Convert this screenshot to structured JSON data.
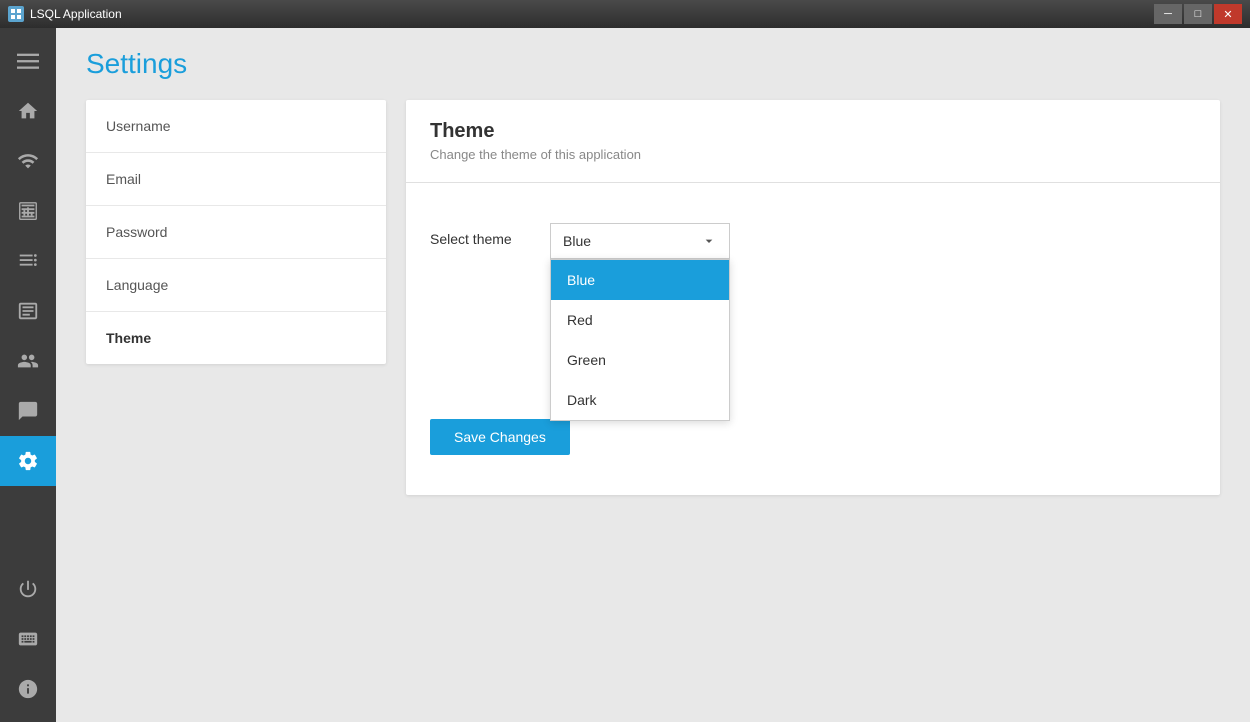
{
  "titlebar": {
    "title": "LSQL Application",
    "controls": {
      "minimize": "─",
      "maximize": "□",
      "close": "✕"
    }
  },
  "sidebar": {
    "items": [
      {
        "name": "menu-icon",
        "label": "Menu",
        "active": false
      },
      {
        "name": "home-icon",
        "label": "Home",
        "active": false
      },
      {
        "name": "wifi-icon",
        "label": "WiFi",
        "active": false
      },
      {
        "name": "chart-icon",
        "label": "Charts",
        "active": false
      },
      {
        "name": "list-icon",
        "label": "List",
        "active": false
      },
      {
        "name": "report-icon",
        "label": "Reports",
        "active": false
      },
      {
        "name": "users-icon",
        "label": "Users",
        "active": false
      },
      {
        "name": "chat-icon",
        "label": "Chat",
        "active": false
      },
      {
        "name": "settings-icon",
        "label": "Settings",
        "active": true
      }
    ],
    "bottom_items": [
      {
        "name": "power-icon",
        "label": "Power"
      },
      {
        "name": "keyboard-icon",
        "label": "Keyboard"
      },
      {
        "name": "info-icon",
        "label": "Info"
      }
    ]
  },
  "page": {
    "title": "Settings"
  },
  "settings_nav": {
    "items": [
      {
        "id": "username",
        "label": "Username",
        "active": false
      },
      {
        "id": "email",
        "label": "Email",
        "active": false
      },
      {
        "id": "password",
        "label": "Password",
        "active": false
      },
      {
        "id": "language",
        "label": "Language",
        "active": false
      },
      {
        "id": "theme",
        "label": "Theme",
        "active": true
      }
    ]
  },
  "theme_panel": {
    "title": "Theme",
    "subtitle": "Change the theme of this application",
    "select_label": "Select theme",
    "selected_value": "Blue",
    "dropdown_options": [
      {
        "value": "Blue",
        "label": "Blue",
        "selected": true
      },
      {
        "value": "Red",
        "label": "Red",
        "selected": false
      },
      {
        "value": "Green",
        "label": "Green",
        "selected": false
      },
      {
        "value": "Dark",
        "label": "Dark",
        "selected": false
      }
    ],
    "save_button_label": "Save Changes"
  }
}
